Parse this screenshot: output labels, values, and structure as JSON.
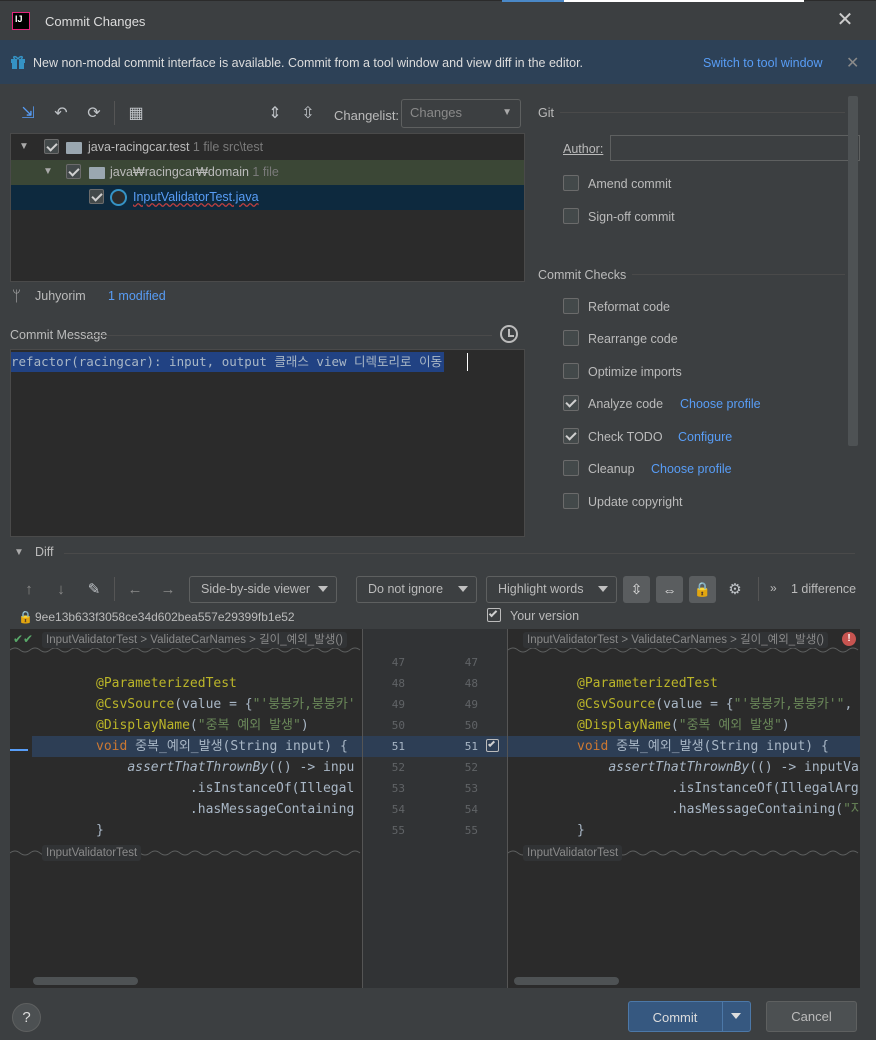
{
  "window": {
    "title": "Commit Changes"
  },
  "banner": {
    "text": "New non-modal commit interface is available. Commit from a tool window and view diff in the editor.",
    "link": "Switch to tool window"
  },
  "toolbar": {
    "changelist_label": "Changelist:",
    "changelist_value": "Changes"
  },
  "tree": {
    "root": {
      "name": "java-racingcar.test",
      "meta": "1 file  src\\test"
    },
    "folder": {
      "name": "java₩racingcar₩domain",
      "meta": "1 file"
    },
    "file": {
      "name": "InputValidatorTest.java"
    }
  },
  "status": {
    "branch": "Juhyorim",
    "modified": "1 modified"
  },
  "commit_message": {
    "label": "Commit Message",
    "text": "refactor(racingcar): input, output 클래스 view 디렉토리로 이동"
  },
  "git": {
    "title": "Git",
    "author_label": "Author:",
    "author_value": "",
    "options": [
      {
        "label": "Amend commit",
        "checked": false
      },
      {
        "label": "Sign-off commit",
        "checked": false
      }
    ]
  },
  "checks": {
    "title": "Commit Checks",
    "items": [
      {
        "label": "Reformat code",
        "checked": false,
        "link": ""
      },
      {
        "label": "Rearrange code",
        "checked": false,
        "link": ""
      },
      {
        "label": "Optimize imports",
        "checked": false,
        "link": ""
      },
      {
        "label": "Analyze code",
        "checked": true,
        "link": "Choose profile"
      },
      {
        "label": "Check TODO",
        "checked": true,
        "link": "Configure"
      },
      {
        "label": "Cleanup",
        "checked": false,
        "link": "Choose profile"
      },
      {
        "label": "Update copyright",
        "checked": false,
        "link": ""
      }
    ]
  },
  "diff": {
    "title": "Diff",
    "viewer": "Side-by-side viewer",
    "ignore": "Do not ignore",
    "highlight": "Highlight words",
    "difference_count": "1 difference",
    "left_hash": "9ee13b633f3058ce34d602bea557e29399fb1e52",
    "right_label": "Your version",
    "breadcrumb_left": "InputValidatorTest > ValidateCarNames > 길이_예외_발생()",
    "breadcrumb_right": "InputValidatorTest > ValidateCarNames > 길이_예외_발생()",
    "footer_left": "InputValidatorTest",
    "footer_right": "InputValidatorTest",
    "line_numbers": [
      "47",
      "48",
      "49",
      "50",
      "51",
      "52",
      "53",
      "54",
      "55"
    ],
    "left_code": [
      "",
      "@ParameterizedTest",
      "@CsvSource(value = {\"'붕붕카,붕붕카'",
      "@DisplayName(\"중복 예외 발생\")",
      "void 중복_예외_발생(String input) {",
      "    assertThatThrownBy(() -> inpu",
      "            .isInstanceOf(Illegal",
      "            .hasMessageContaining",
      "}"
    ],
    "right_code": [
      "",
      "@ParameterizedTest",
      "@CsvSource(value = {\"'붕붕카,붕붕카'\",",
      "@DisplayName(\"중복 예외 발생\")",
      "void 중복_예외_발생(String input) {",
      "    assertThatThrownBy(() -> inputVa",
      "            .isInstanceOf(IllegalArg",
      "            .hasMessageContaining(\"자",
      "}"
    ]
  },
  "buttons": {
    "commit": "Commit",
    "cancel": "Cancel",
    "help": "?"
  }
}
